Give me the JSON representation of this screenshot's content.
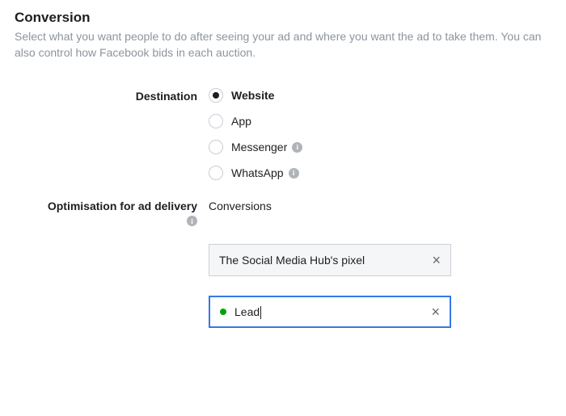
{
  "section": {
    "title": "Conversion",
    "description": "Select what you want people to do after seeing your ad and where you want the ad to take them. You can also control how Facebook bids in each auction."
  },
  "destination": {
    "label": "Destination",
    "options": {
      "website": "Website",
      "app": "App",
      "messenger": "Messenger",
      "whatsapp": "WhatsApp"
    },
    "selected": "website"
  },
  "optimisation": {
    "label": "Optimisation for ad delivery",
    "value": "Conversions"
  },
  "pixel_field": {
    "value": "The Social Media Hub's pixel"
  },
  "event_field": {
    "value": "Lead"
  },
  "icons": {
    "info_glyph": "i",
    "clear_glyph": "×"
  }
}
